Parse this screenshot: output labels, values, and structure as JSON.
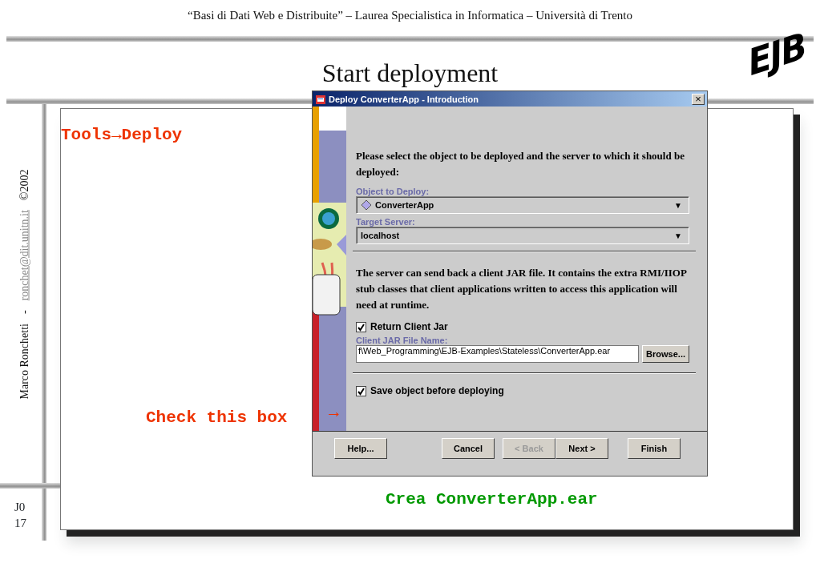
{
  "header": {
    "course": "“Basi di Dati Web e Distribuite” – Laurea Specialistica in Informatica – Università di Trento",
    "title": "Start deployment",
    "logo": "EJB"
  },
  "sidebar": {
    "author": "Marco Ronchetti",
    "separator": "-",
    "email": "ronchet@dit.unitn.it",
    "copyright": "©2002",
    "slide_code": "J0",
    "page": "17"
  },
  "notes": [
    {
      "text": "Tools→Deploy",
      "color": "#ee3300"
    },
    {
      "text": "Check this box",
      "color": "#ee3300"
    },
    {
      "text": "→",
      "color": "#ee3300"
    },
    {
      "text": "Crea ConverterApp.ear",
      "color": "#009900"
    }
  ],
  "dialog": {
    "title": "Deploy ConverterApp - Introduction",
    "close": "×",
    "intro": "Please select the object to be deployed and the server to which it should be deployed:",
    "object_label": "Object to Deploy:",
    "object_value": "ConverterApp",
    "caret_1": "▼",
    "server_label": "Target Server:",
    "server_value": "localhost",
    "caret_2": "▼",
    "info": "The server can send back a client JAR file. It contains the extra RMI/IIOP stub classes that client applications written to access this application will need at runtime.",
    "return_jar": {
      "label": "Return Client Jar",
      "checked": true
    },
    "jar_label": "Client JAR File Name:",
    "jar_value": "f\\Web_Programming\\EJB-Examples\\Stateless\\ConverterApp.ear",
    "browse": "Browse...",
    "save": {
      "label": "Save object before deploying",
      "checked": true
    },
    "buttons": [
      {
        "label": "Help...",
        "disabled": false
      },
      {
        "label": "Cancel",
        "disabled": false
      },
      {
        "label": "< Back",
        "disabled": true
      },
      {
        "label": "Next >",
        "disabled": false
      },
      {
        "label": "Finish",
        "disabled": false
      }
    ]
  }
}
